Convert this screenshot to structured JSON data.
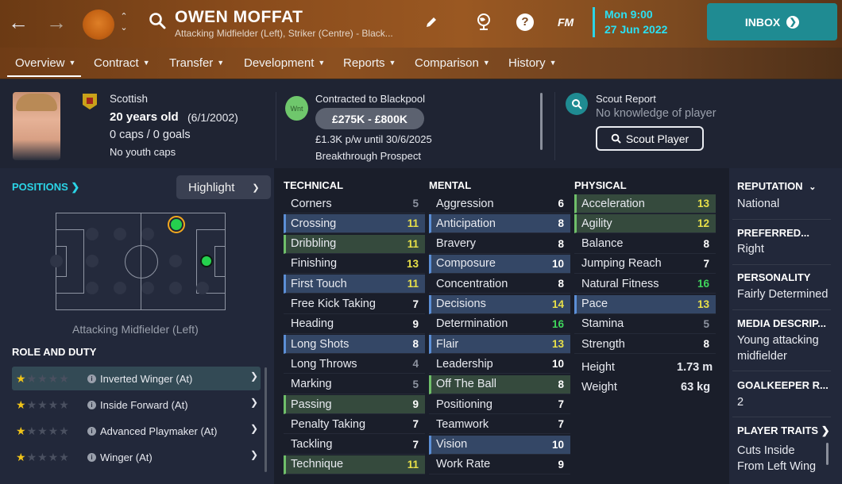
{
  "topbar": {
    "back_icon": "arrow-left-icon",
    "forward_icon": "arrow-right-icon",
    "player_name": "OWEN MOFFAT",
    "player_subtitle": "Attacking Midfielder (Left), Striker (Centre) - Black...",
    "day_time": "Mon 9:00",
    "date": "27 Jun 2022",
    "inbox_label": "INBOX",
    "fm_label": "FM"
  },
  "tabs": [
    {
      "label": "Overview"
    },
    {
      "label": "Contract"
    },
    {
      "label": "Transfer"
    },
    {
      "label": "Development"
    },
    {
      "label": "Reports"
    },
    {
      "label": "Comparison"
    },
    {
      "label": "History"
    }
  ],
  "header": {
    "nationality": "Scottish",
    "age": "20 years old",
    "dob": "(6/1/2002)",
    "caps": "0 caps / 0 goals",
    "youth_caps": "No youth caps",
    "wnt_badge": "Wnt",
    "contract": "Contracted to Blackpool",
    "value": "£275K - £800K",
    "wage": "£1.3K p/w until 30/6/2025",
    "status": "Breakthrough Prospect",
    "scout_title": "Scout Report",
    "scout_sub": "No knowledge of player",
    "scout_button": "Scout Player"
  },
  "positions": {
    "title": "POSITIONS",
    "highlight_label": "Highlight",
    "position_text": "Attacking Midfielder (Left)"
  },
  "roles": {
    "title": "ROLE AND DUTY",
    "items": [
      {
        "name": "Inverted Winger (At)",
        "stars": 1
      },
      {
        "name": "Inside Forward (At)",
        "stars": 1
      },
      {
        "name": "Advanced Playmaker (At)",
        "stars": 1
      },
      {
        "name": "Winger (At)",
        "stars": 1
      }
    ]
  },
  "technical": {
    "title": "TECHNICAL",
    "items": [
      {
        "name": "Corners",
        "value": "5",
        "color": "grey",
        "hl": ""
      },
      {
        "name": "Crossing",
        "value": "11",
        "color": "yellow",
        "hl": "blue"
      },
      {
        "name": "Dribbling",
        "value": "11",
        "color": "yellow",
        "hl": "green"
      },
      {
        "name": "Finishing",
        "value": "13",
        "color": "yellow",
        "hl": ""
      },
      {
        "name": "First Touch",
        "value": "11",
        "color": "yellow",
        "hl": "blue"
      },
      {
        "name": "Free Kick Taking",
        "value": "7",
        "color": "white",
        "hl": ""
      },
      {
        "name": "Heading",
        "value": "9",
        "color": "white",
        "hl": ""
      },
      {
        "name": "Long Shots",
        "value": "8",
        "color": "white",
        "hl": "blue"
      },
      {
        "name": "Long Throws",
        "value": "4",
        "color": "grey",
        "hl": ""
      },
      {
        "name": "Marking",
        "value": "5",
        "color": "grey",
        "hl": ""
      },
      {
        "name": "Passing",
        "value": "9",
        "color": "white",
        "hl": "green"
      },
      {
        "name": "Penalty Taking",
        "value": "7",
        "color": "white",
        "hl": ""
      },
      {
        "name": "Tackling",
        "value": "7",
        "color": "white",
        "hl": ""
      },
      {
        "name": "Technique",
        "value": "11",
        "color": "yellow",
        "hl": "green"
      }
    ]
  },
  "mental": {
    "title": "MENTAL",
    "items": [
      {
        "name": "Aggression",
        "value": "6",
        "color": "white",
        "hl": ""
      },
      {
        "name": "Anticipation",
        "value": "8",
        "color": "white",
        "hl": "blue"
      },
      {
        "name": "Bravery",
        "value": "8",
        "color": "white",
        "hl": ""
      },
      {
        "name": "Composure",
        "value": "10",
        "color": "white",
        "hl": "blue"
      },
      {
        "name": "Concentration",
        "value": "8",
        "color": "white",
        "hl": ""
      },
      {
        "name": "Decisions",
        "value": "14",
        "color": "yellow",
        "hl": "blue"
      },
      {
        "name": "Determination",
        "value": "16",
        "color": "green",
        "hl": ""
      },
      {
        "name": "Flair",
        "value": "13",
        "color": "yellow",
        "hl": "blue"
      },
      {
        "name": "Leadership",
        "value": "10",
        "color": "white",
        "hl": ""
      },
      {
        "name": "Off The Ball",
        "value": "8",
        "color": "white",
        "hl": "green"
      },
      {
        "name": "Positioning",
        "value": "7",
        "color": "white",
        "hl": ""
      },
      {
        "name": "Teamwork",
        "value": "7",
        "color": "white",
        "hl": ""
      },
      {
        "name": "Vision",
        "value": "10",
        "color": "white",
        "hl": "blue"
      },
      {
        "name": "Work Rate",
        "value": "9",
        "color": "white",
        "hl": ""
      }
    ]
  },
  "physical": {
    "title": "PHYSICAL",
    "items": [
      {
        "name": "Acceleration",
        "value": "13",
        "color": "yellow",
        "hl": "green"
      },
      {
        "name": "Agility",
        "value": "12",
        "color": "yellow",
        "hl": "green"
      },
      {
        "name": "Balance",
        "value": "8",
        "color": "white",
        "hl": ""
      },
      {
        "name": "Jumping Reach",
        "value": "7",
        "color": "white",
        "hl": ""
      },
      {
        "name": "Natural Fitness",
        "value": "16",
        "color": "green",
        "hl": ""
      },
      {
        "name": "Pace",
        "value": "13",
        "color": "yellow",
        "hl": "blue"
      },
      {
        "name": "Stamina",
        "value": "5",
        "color": "grey",
        "hl": ""
      },
      {
        "name": "Strength",
        "value": "8",
        "color": "white",
        "hl": ""
      }
    ],
    "height_label": "Height",
    "height_value": "1.73 m",
    "weight_label": "Weight",
    "weight_value": "63 kg"
  },
  "sidebar": {
    "reputation_title": "REPUTATION",
    "reputation_value": "National",
    "foot_title": "PREFERRED...",
    "foot_value": "Right",
    "personality_title": "PERSONALITY",
    "personality_value": "Fairly Determined",
    "media_title": "MEDIA DESCRIP...",
    "media_value": "Young attacking midfielder",
    "gk_title": "GOALKEEPER R...",
    "gk_value": "2",
    "traits_title": "PLAYER TRAITS",
    "traits_value": "Cuts Inside From Left Wing"
  },
  "colors": {
    "accent": "#2bd4e6",
    "inbox": "#1f8b92",
    "yellow": "#e8e048",
    "green": "#3fd65c"
  }
}
